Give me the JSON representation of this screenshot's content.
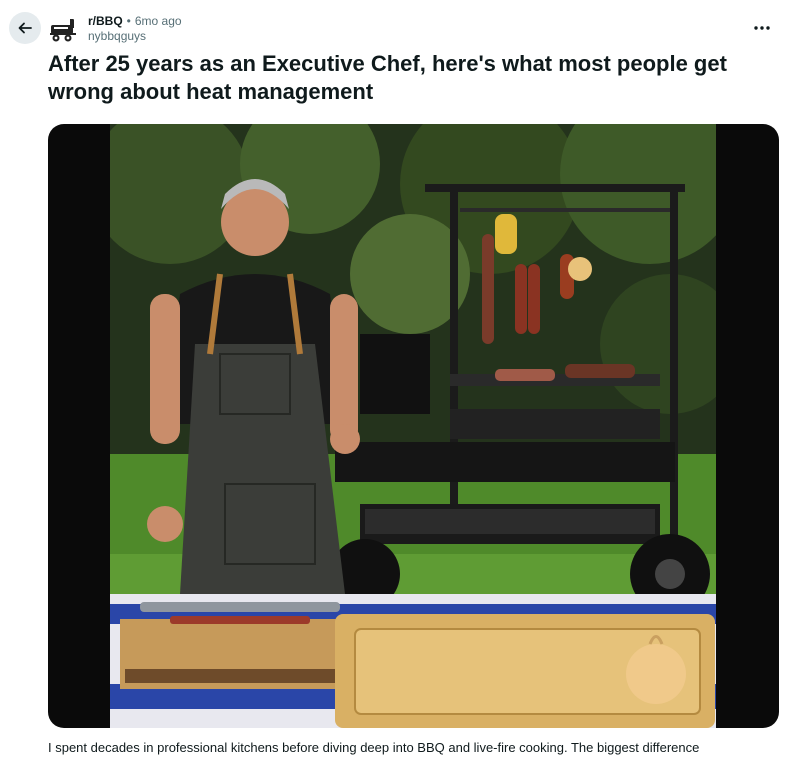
{
  "post": {
    "subreddit": "r/BBQ",
    "separator": "•",
    "age": "6mo ago",
    "author": "nybbqguys",
    "title": "After 25 years as an Executive Chef, here's what most people get wrong about heat management",
    "body_preview": "I spent decades in professional kitchens before diving deep into BBQ and live-fire cooking. The biggest difference"
  },
  "icons": {
    "back": "arrow-left-icon",
    "more": "ellipsis-icon",
    "avatar": "bbq-smoker-icon"
  },
  "colors": {
    "back_button_bg": "#e5ebee",
    "text_primary": "#0f1a1c",
    "text_secondary": "#576f76"
  }
}
